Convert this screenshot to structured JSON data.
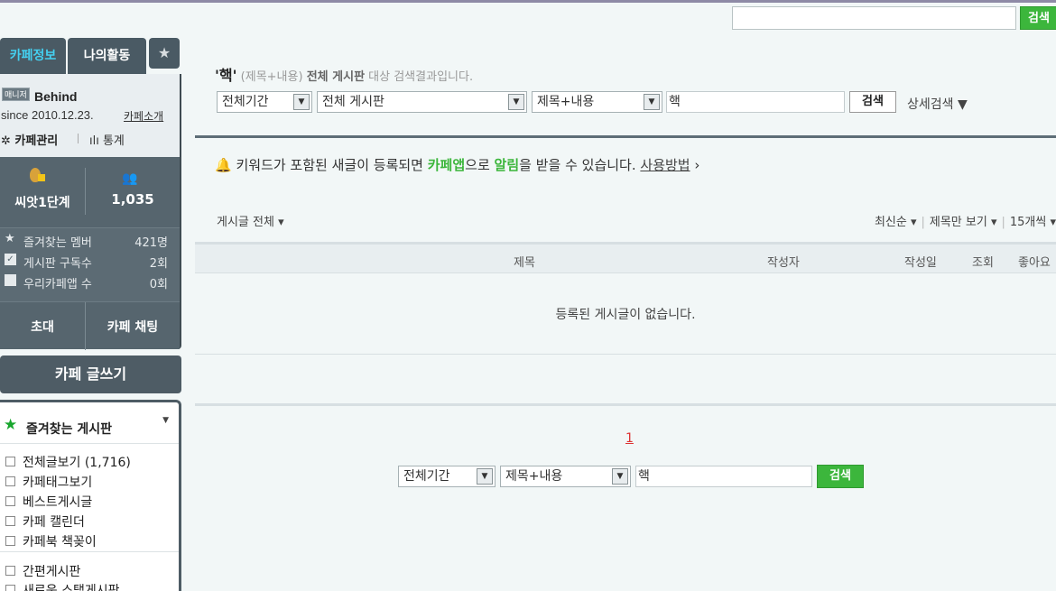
{
  "top_search": {
    "value": "",
    "button": "검색"
  },
  "sidebar": {
    "tabs": {
      "info": "카페정보",
      "activity": "나의활동",
      "star": "★"
    },
    "cafe": {
      "badge": "매니저",
      "name": "Behind",
      "since": "since 2010.12.23.",
      "intro_link": "카페소개",
      "manage": "✲ 카페관리",
      "stats": "ılı 통계"
    },
    "level": {
      "name": "씨앗1단계",
      "members": "1,035"
    },
    "stats": [
      {
        "label": "즐겨찾는 멤버",
        "value": "421명"
      },
      {
        "label": "게시판 구독수",
        "value": "2회"
      },
      {
        "label": "우리카페앱 수",
        "value": "0회"
      }
    ],
    "actions": {
      "invite": "초대",
      "chat": "카페 채팅"
    },
    "write": "카페 글쓰기",
    "favorites": {
      "title": "즐겨찾는 게시판",
      "caret": "▼",
      "items": [
        {
          "label": "전체글보기 (1,716)"
        },
        {
          "label": "카페태그보기"
        },
        {
          "label": "베스트게시글"
        },
        {
          "label": "카페 캘린더"
        },
        {
          "label": "카페북 책꽂이"
        },
        {
          "label": "간편게시판"
        },
        {
          "label": "새로운 스탭게시판"
        }
      ]
    }
  },
  "main": {
    "result": {
      "keyword": "'핵'",
      "scope": "(제목+내용)",
      "board": "전체 게시판",
      "suffix": "대상 검색결과입니다."
    },
    "search": {
      "period": "전체기간",
      "board": "전체 게시판",
      "field": "제목+내용",
      "query": "핵",
      "button": "검색",
      "detail": "상세검색 ▼"
    },
    "alert": {
      "bell": "🔔",
      "pre": "키워드가 포함된 새글이 등록되면 ",
      "app": "카페앱",
      "mid": "으로 ",
      "notify": "알림",
      "post": "을 받을 수 있습니다. ",
      "howto": "사용방법",
      "arrow": "›"
    },
    "filter": "게시글 전체 ▾",
    "sort": {
      "latest": "최신순 ▾",
      "title_only": "제목만 보기 ▾",
      "count": "15개씩 ▾"
    },
    "table": {
      "headers": {
        "title": "제목",
        "author": "작성자",
        "date": "작성일",
        "views": "조회",
        "likes": "좋아요"
      },
      "empty": "등록된 게시글이 없습니다."
    },
    "pagination": {
      "current": "1"
    },
    "bottom_search": {
      "period": "전체기간",
      "field": "제목+내용",
      "query": "핵",
      "button": "검색"
    }
  }
}
